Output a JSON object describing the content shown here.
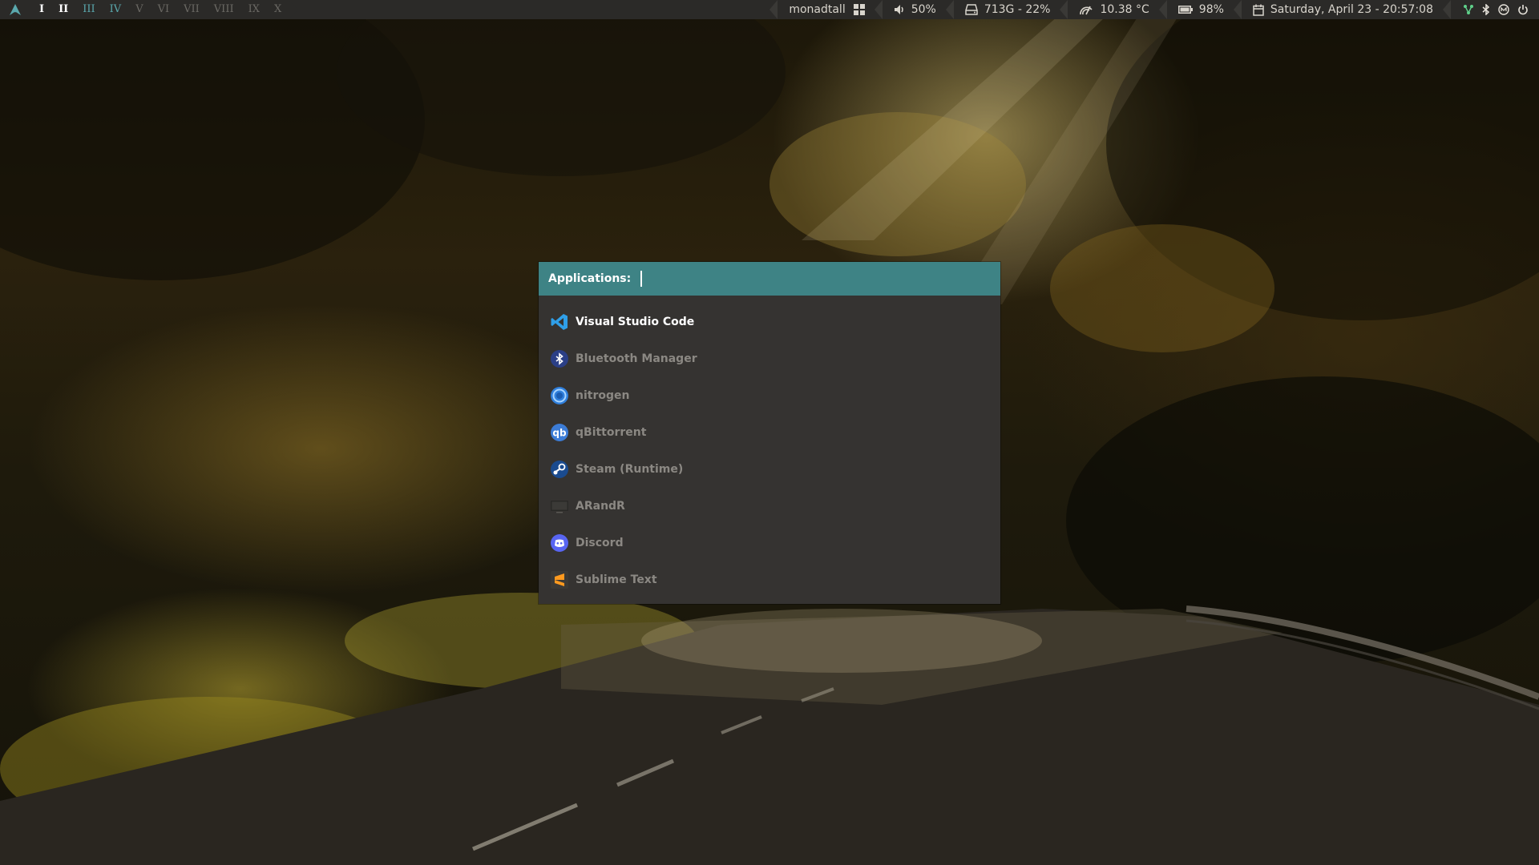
{
  "desktop": {
    "wallpaper": "forest road at dusk"
  },
  "topbar": {
    "logo_icon": "arch-logo-icon",
    "workspaces": [
      {
        "label": "I",
        "state": "occupied"
      },
      {
        "label": "II",
        "state": "occupied"
      },
      {
        "label": "III",
        "state": "teal"
      },
      {
        "label": "IV",
        "state": "teal"
      },
      {
        "label": "V",
        "state": "empty"
      },
      {
        "label": "VI",
        "state": "empty"
      },
      {
        "label": "VII",
        "state": "empty"
      },
      {
        "label": "VIII",
        "state": "empty"
      },
      {
        "label": "IX",
        "state": "empty"
      },
      {
        "label": "X",
        "state": "empty"
      }
    ],
    "layout_name": "monadtall",
    "volume": "50%",
    "disk": "713G - 22%",
    "temperature": "10.38 °C",
    "battery": "98%",
    "datetime": "Saturday, April 23 - 20:57:08",
    "tray_icons": [
      "network-icon",
      "bluetooth-icon",
      "vpn-icon",
      "power-icon"
    ]
  },
  "launcher": {
    "prompt": "Applications:",
    "query": "",
    "items": [
      {
        "label": "Visual Studio Code",
        "icon": "vscode-icon",
        "selected": true
      },
      {
        "label": "Bluetooth Manager",
        "icon": "bluetooth-manager-icon",
        "selected": false
      },
      {
        "label": "nitrogen",
        "icon": "nitrogen-icon",
        "selected": false
      },
      {
        "label": "qBittorrent",
        "icon": "qbittorrent-icon",
        "selected": false
      },
      {
        "label": "Steam (Runtime)",
        "icon": "steam-icon",
        "selected": false
      },
      {
        "label": "ARandR",
        "icon": "arandr-icon",
        "selected": false
      },
      {
        "label": "Discord",
        "icon": "discord-icon",
        "selected": false
      },
      {
        "label": "Sublime Text",
        "icon": "sublime-text-icon",
        "selected": false
      }
    ]
  },
  "colors": {
    "bar_bg": "#2b2a28",
    "accent_teal": "#3e8385",
    "launcher_bg": "#353331",
    "item_dim": "#8b8883",
    "item_selected": "#ffffff"
  }
}
